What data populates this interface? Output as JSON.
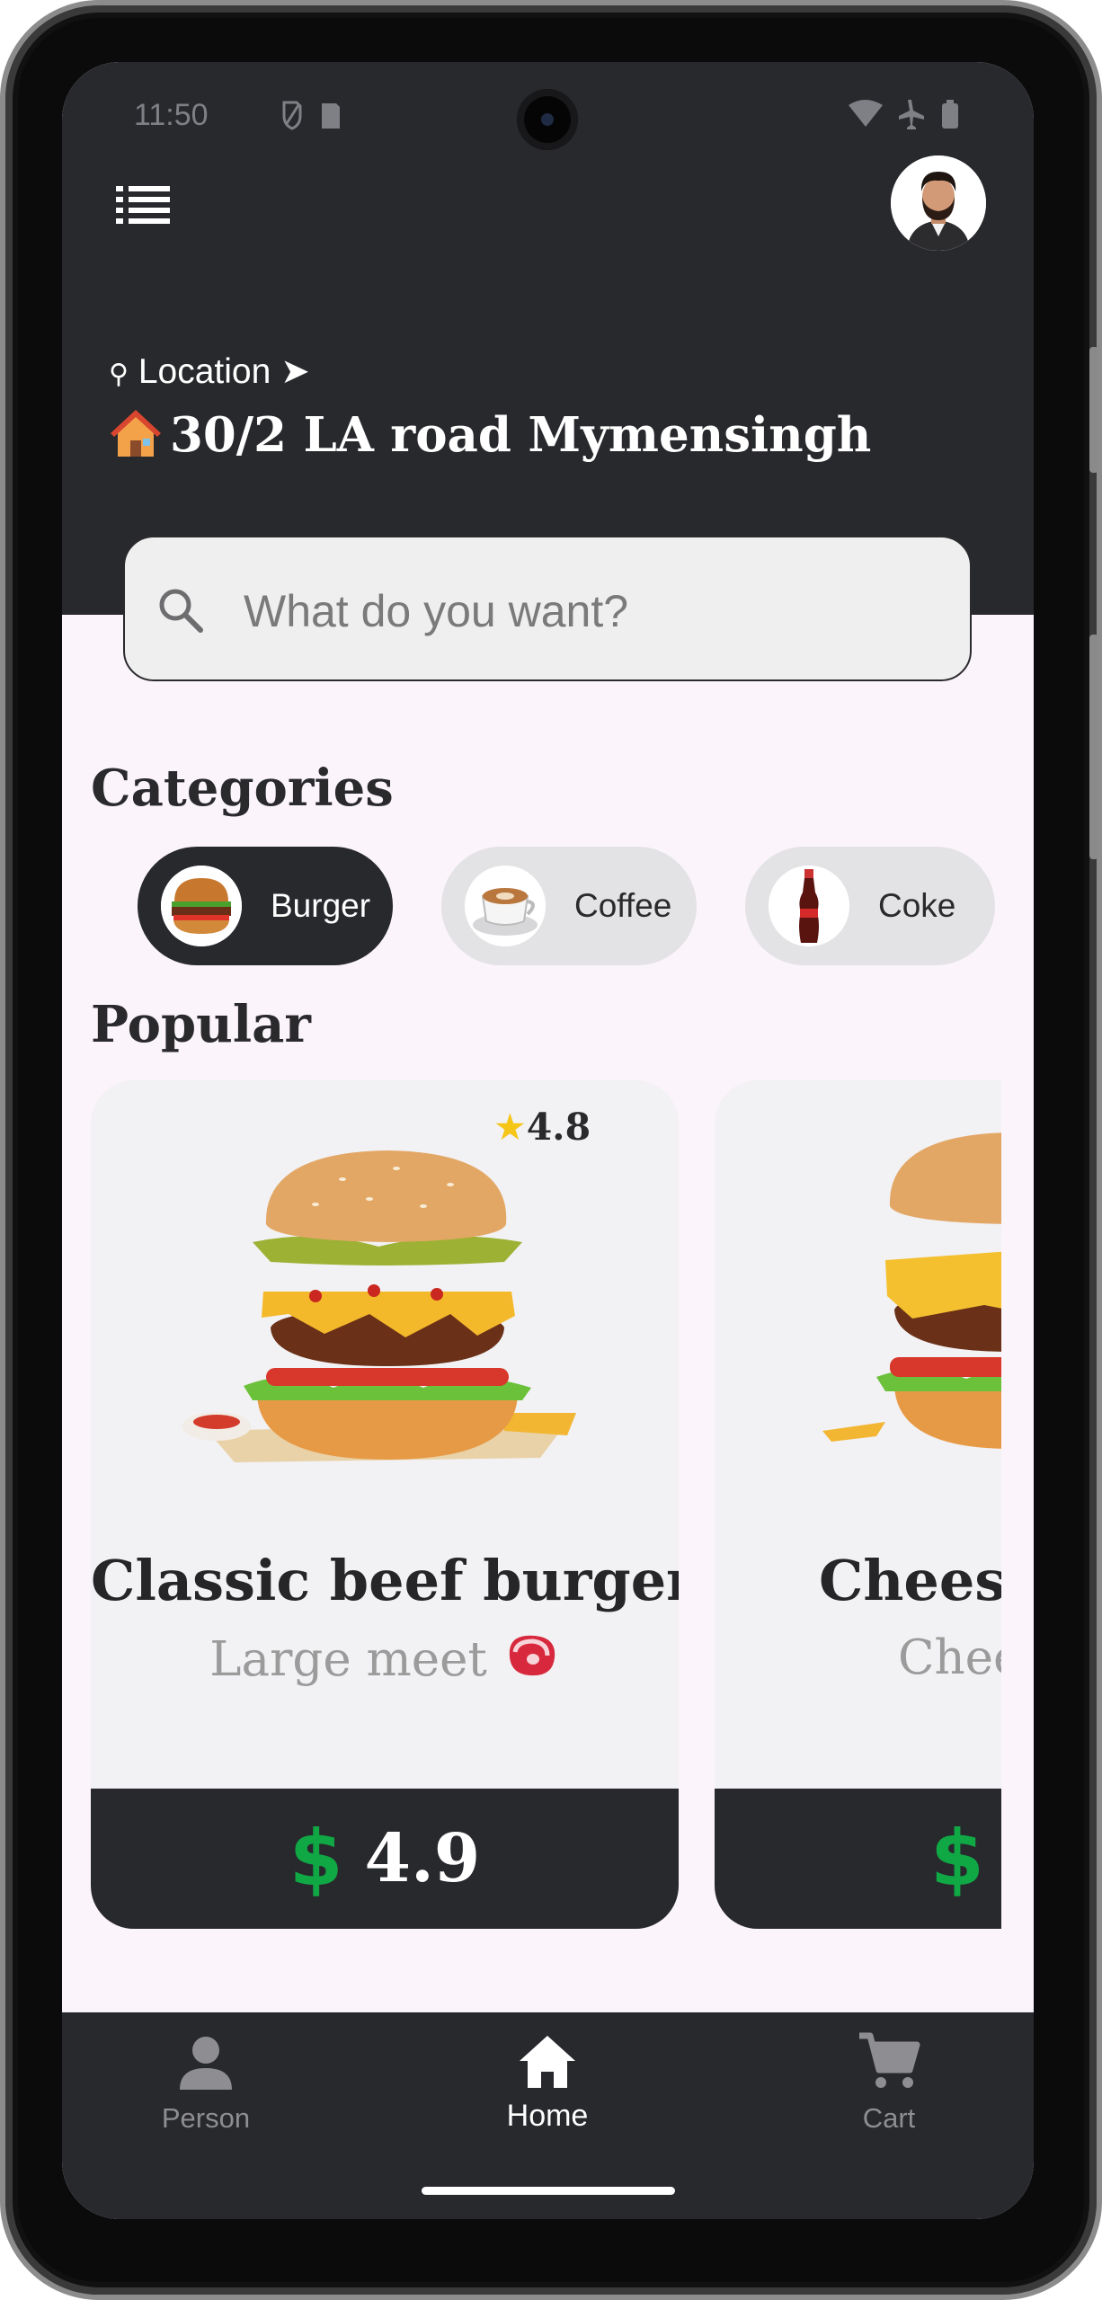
{
  "status_bar": {
    "time": "11:50"
  },
  "header": {
    "location_label": "Location ➤",
    "address": "30/2 LA road Mymensingh",
    "location_icon": "pin-icon",
    "address_icon": "house-emoji"
  },
  "search": {
    "placeholder": "What do you want?"
  },
  "categories": {
    "title": "Categories",
    "items": [
      {
        "label": "Burger",
        "selected": true
      },
      {
        "label": "Coffee",
        "selected": false
      },
      {
        "label": "Coke",
        "selected": false
      }
    ]
  },
  "popular": {
    "title": "Popular",
    "items": [
      {
        "name": "Classic beef burger",
        "description": "Large meet",
        "rating": "4.8",
        "currency": "$",
        "price": "4.9"
      },
      {
        "name": "Cheese",
        "description": "Chee",
        "currency": "$"
      }
    ]
  },
  "nav": {
    "items": [
      {
        "label": "Person",
        "icon": "person-icon",
        "active": false
      },
      {
        "label": "Home",
        "icon": "home-icon",
        "active": true
      },
      {
        "label": "Cart",
        "icon": "cart-icon",
        "active": false
      }
    ]
  },
  "colors": {
    "dark": "#28292d",
    "background": "#fbf4fb",
    "chip_inactive": "#e3e2e4",
    "price_currency": "#10a745",
    "nav_inactive": "#8e8e92"
  }
}
